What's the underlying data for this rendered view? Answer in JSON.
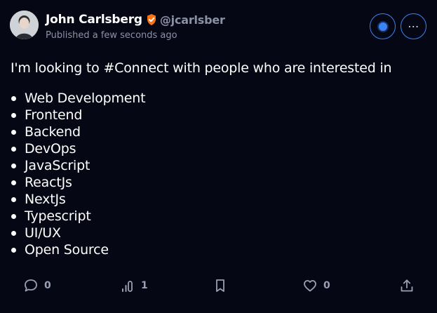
{
  "author": {
    "name": "John Carlsberg",
    "handle": "@jcarlsber",
    "published": "Published a few seconds ago"
  },
  "post": {
    "intro": "I'm looking to #Connect with people who are interested in",
    "interests": [
      "Web Development",
      "Frontend",
      "Backend",
      "DevOps",
      "JavaScript",
      "ReactJs",
      "NextJs",
      "Typescript",
      "UI/UX",
      "Open Source"
    ]
  },
  "actions": {
    "comments": "0",
    "views": "1",
    "likes": "0"
  },
  "icons": {
    "verified": "verified-shield-icon",
    "comment": "comment-icon",
    "views": "analytics-icon",
    "bookmark": "bookmark-icon",
    "like": "heart-icon",
    "share": "share-icon",
    "more": "more-icon"
  },
  "colors": {
    "background": "#050714",
    "accent": "#3b82f6",
    "verified": "#f97316",
    "muted": "#8b92a7"
  }
}
